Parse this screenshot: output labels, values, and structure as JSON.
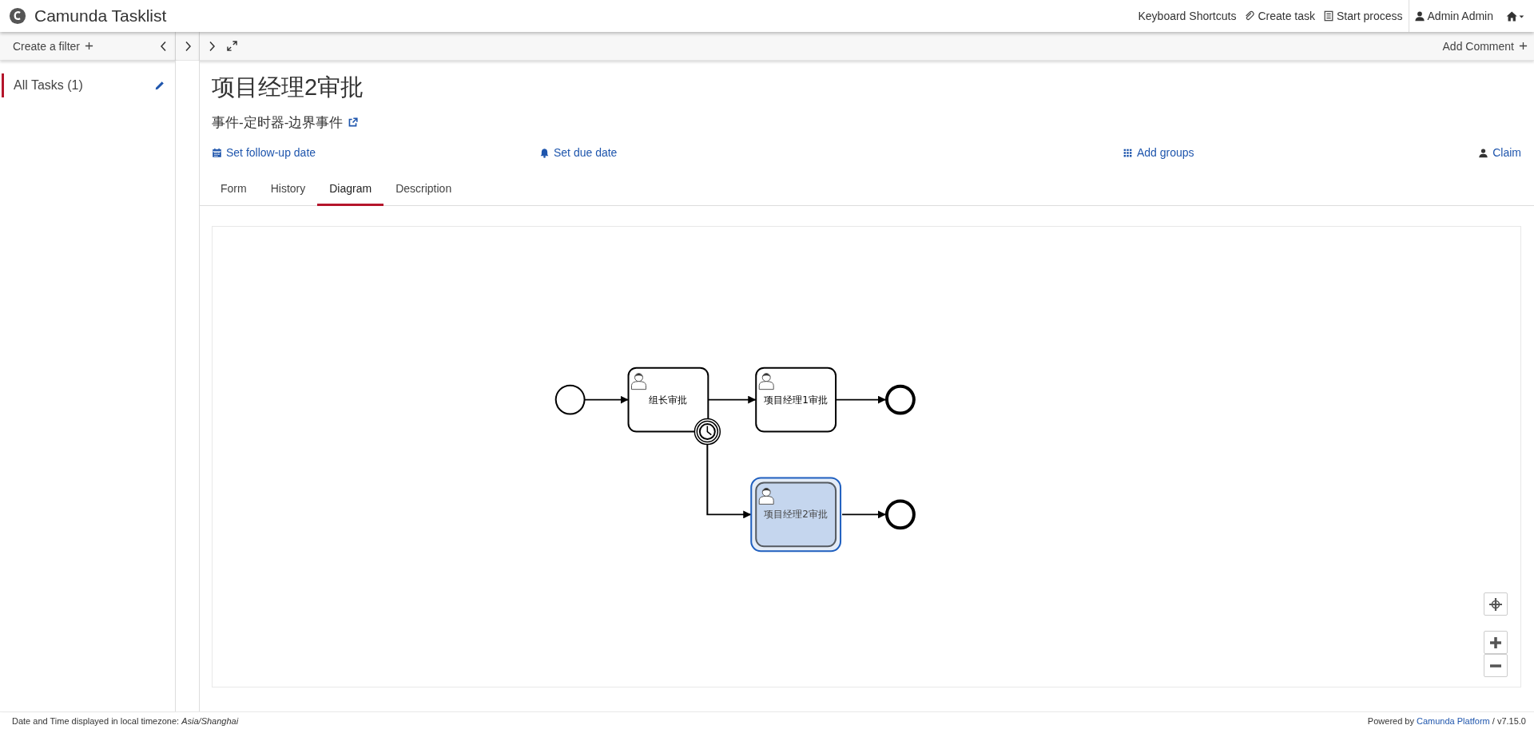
{
  "header": {
    "title": "Camunda Tasklist",
    "nav": [
      {
        "label": "Keyboard Shortcuts",
        "kind": "text"
      },
      {
        "label": "Create task",
        "kind": "paperclip"
      },
      {
        "label": "Start process",
        "kind": "list"
      },
      {
        "label": "Admin Admin",
        "kind": "user"
      }
    ]
  },
  "sidebar": {
    "create_filter": "Create a filter",
    "filters": [
      {
        "label": "All Tasks (1)",
        "selected": true
      }
    ]
  },
  "task": {
    "add_comment": "Add Comment",
    "title": "项目经理2审批",
    "process": "事件-定时器-边界事件",
    "actions": [
      {
        "label": "Set follow-up date",
        "kind": "calendar"
      },
      {
        "label": "Set due date",
        "kind": "bell"
      },
      {
        "label": "Add groups",
        "kind": "grid"
      },
      {
        "label": "Claim",
        "kind": "user"
      }
    ],
    "tabs": [
      {
        "label": "Form",
        "selected": false
      },
      {
        "label": "History",
        "selected": false
      },
      {
        "label": "Diagram",
        "selected": true
      },
      {
        "label": "Description",
        "selected": false
      }
    ]
  },
  "diagram": {
    "tasks": [
      {
        "label": "组长审批",
        "selected": false
      },
      {
        "label": "项目经理1审批",
        "selected": false
      },
      {
        "label": "项目经理2审批",
        "selected": true
      }
    ]
  },
  "footer": {
    "timezone": "Date and Time displayed in local timezone: *Asia/Shanghai*",
    "powered_prefix": "Powered by",
    "link": "Camunda Platform",
    "version": "/ v7.15.0"
  }
}
